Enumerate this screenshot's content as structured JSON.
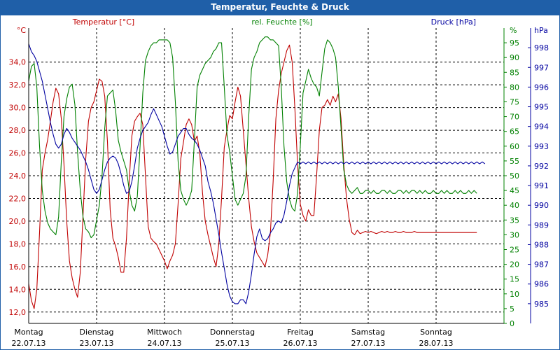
{
  "window": {
    "title": "Temperatur, Feuchte & Druck"
  },
  "chart_data": {
    "type": "line",
    "x": [
      "Montag 22.07.13",
      "Dienstag 23.07.13",
      "Mittwoch 24.07.13",
      "Donnerstag 25.07.13",
      "Freitag 26.07.13",
      "Samstag 27.07.13",
      "Sonntag 28.07.13"
    ],
    "x_days": [
      "Montag",
      "Dienstag",
      "Mittwoch",
      "Donnerstag",
      "Freitag",
      "Samstag",
      "Sonntag"
    ],
    "x_dates": [
      "22.07.13",
      "23.07.13",
      "24.07.13",
      "25.07.13",
      "26.07.13",
      "27.07.13",
      "28.07.13"
    ],
    "grid": true,
    "axes": {
      "temperature": {
        "label": "Temperatur [°C]",
        "unit": "°C",
        "ylim": [
          11,
          37
        ],
        "ticks": [
          12.0,
          14.0,
          16.0,
          18.0,
          20.0,
          22.0,
          24.0,
          26.0,
          28.0,
          30.0,
          32.0,
          34.0
        ],
        "tick_labels": [
          "12,0",
          "14,0",
          "16,0",
          "18,0",
          "20,0",
          "22,0",
          "24,0",
          "26,0",
          "28,0",
          "30,0",
          "32,0",
          "34,0"
        ],
        "color": "#c00000"
      },
      "humidity": {
        "label": "rel. Feuchte [%]",
        "unit": "%",
        "ylim": [
          0,
          100
        ],
        "ticks": [
          0,
          5,
          10,
          15,
          20,
          25,
          30,
          35,
          40,
          45,
          50,
          55,
          60,
          65,
          70,
          75,
          80,
          85,
          90,
          95
        ],
        "color": "#008000"
      },
      "pressure": {
        "label": "Druck [hPa]",
        "unit": "hPa",
        "ylim": [
          984,
          999
        ],
        "ticks": [
          985,
          986,
          987,
          988,
          989,
          990,
          991,
          992,
          993,
          994,
          995,
          996,
          997,
          998
        ],
        "color": "#0000a0"
      }
    },
    "series": [
      {
        "name": "Temperatur [°C]",
        "axis": "temperature",
        "color": "#c00000",
        "x_days": [
          0,
          0.04,
          0.08,
          0.12,
          0.16,
          0.2,
          0.24,
          0.28,
          0.32,
          0.36,
          0.4,
          0.44,
          0.48,
          0.52,
          0.56,
          0.6,
          0.64,
          0.68,
          0.72,
          0.76,
          0.8,
          0.84,
          0.88,
          0.92,
          0.96,
          1.0,
          1.04,
          1.08,
          1.12,
          1.16,
          1.2,
          1.24,
          1.28,
          1.32,
          1.36,
          1.4,
          1.44,
          1.48,
          1.52,
          1.56,
          1.6,
          1.64,
          1.68,
          1.72,
          1.76,
          1.8,
          1.84,
          1.88,
          1.92,
          1.96,
          2.0,
          2.04,
          2.08,
          2.12,
          2.16,
          2.2,
          2.24,
          2.28,
          2.32,
          2.36,
          2.4,
          2.44,
          2.48,
          2.52,
          2.56,
          2.6,
          2.64,
          2.68,
          2.72,
          2.76,
          2.8,
          2.84,
          2.88,
          2.92,
          2.96,
          3.0,
          3.04,
          3.08,
          3.12,
          3.16,
          3.2,
          3.24,
          3.28,
          3.32,
          3.36,
          3.4,
          3.44,
          3.48,
          3.52,
          3.56,
          3.6,
          3.64,
          3.68,
          3.72,
          3.76,
          3.8,
          3.84,
          3.88,
          3.92,
          3.96,
          4.0,
          4.04,
          4.08,
          4.12,
          4.16,
          4.2,
          4.24,
          4.28,
          4.32,
          4.36,
          4.4,
          4.44,
          4.48,
          4.52,
          4.56,
          4.6,
          4.64,
          4.68,
          4.72,
          4.76,
          4.8,
          4.84,
          4.88,
          4.92,
          4.96,
          5.0,
          5.04,
          5.08,
          5.12,
          5.16,
          5.2,
          5.24,
          5.28,
          5.32,
          5.36,
          5.4,
          5.44,
          5.48,
          5.52,
          5.56,
          5.6,
          5.64,
          5.68,
          5.72,
          5.76,
          5.8,
          5.84,
          5.88,
          5.92,
          5.96,
          6.0,
          6.04,
          6.08,
          6.12,
          6.16,
          6.2,
          6.24,
          6.28,
          6.32,
          6.36,
          6.4,
          6.44,
          6.48,
          6.52,
          6.56,
          6.6,
          6.64,
          6.68,
          6.72,
          6.76,
          6.8,
          6.84,
          6.88,
          6.92,
          6.96
        ],
        "values": [
          14.5,
          13.0,
          12.3,
          14.0,
          19.0,
          24.5,
          26.0,
          27.2,
          28.8,
          30.5,
          31.7,
          31.2,
          29.0,
          25.0,
          20.0,
          16.5,
          15.0,
          14.0,
          13.3,
          15.5,
          20.5,
          25.5,
          28.8,
          30.0,
          30.5,
          31.5,
          32.5,
          32.3,
          31.0,
          27.0,
          21.0,
          18.5,
          17.8,
          16.8,
          15.5,
          15.5,
          18.5,
          23.5,
          27.5,
          28.8,
          29.2,
          29.5,
          28.5,
          24.0,
          19.5,
          18.5,
          18.2,
          18.0,
          17.5,
          17.0,
          16.5,
          15.8,
          16.5,
          17.0,
          18.0,
          21.5,
          25.5,
          27.0,
          28.5,
          29.0,
          28.5,
          27.0,
          27.5,
          26.0,
          22.5,
          20.0,
          18.8,
          17.8,
          16.8,
          16.0,
          18.0,
          22.0,
          26.5,
          28.0,
          29.3,
          29.0,
          30.5,
          31.8,
          31.0,
          28.0,
          25.0,
          22.0,
          19.5,
          18.2,
          17.2,
          16.8,
          16.4,
          16.0,
          17.0,
          19.0,
          23.5,
          29.0,
          31.5,
          33.0,
          34.0,
          35.0,
          35.5,
          34.0,
          30.0,
          25.0,
          21.5,
          20.5,
          20.0,
          21.0,
          20.5,
          20.5,
          24.0,
          28.0,
          30.0,
          30.2,
          30.7,
          30.2,
          31.0,
          30.5,
          31.2,
          29.0,
          25.0,
          22.0,
          20.2,
          19.0,
          18.8,
          19.2,
          18.9,
          19.0,
          19.1,
          19.0,
          19.1,
          19.0,
          18.9,
          19.0,
          19.1,
          19.0,
          19.1,
          19.0,
          19.0,
          19.1,
          19.0,
          19.0,
          19.1,
          19.0,
          19.0,
          19.0,
          19.1,
          19.0,
          19.0,
          19.0,
          19.0,
          19.0,
          19.0,
          19.0,
          19.0,
          19.0,
          19.0,
          19.0,
          19.0,
          19.0,
          19.0,
          19.0,
          19.0,
          19.0,
          19.0,
          19.0,
          19.0,
          19.0,
          19.0,
          19.0
        ]
      },
      {
        "name": "rel. Feuchte [%]",
        "axis": "humidity",
        "color": "#008000",
        "x_days": [
          0,
          0.04,
          0.08,
          0.12,
          0.16,
          0.2,
          0.24,
          0.28,
          0.32,
          0.36,
          0.4,
          0.44,
          0.48,
          0.52,
          0.56,
          0.6,
          0.64,
          0.68,
          0.72,
          0.76,
          0.8,
          0.84,
          0.88,
          0.92,
          0.96,
          1.0,
          1.04,
          1.08,
          1.12,
          1.16,
          1.2,
          1.24,
          1.28,
          1.32,
          1.36,
          1.4,
          1.44,
          1.48,
          1.52,
          1.56,
          1.6,
          1.64,
          1.68,
          1.72,
          1.76,
          1.8,
          1.84,
          1.88,
          1.92,
          1.96,
          2.0,
          2.04,
          2.08,
          2.12,
          2.16,
          2.2,
          2.24,
          2.28,
          2.32,
          2.36,
          2.4,
          2.44,
          2.48,
          2.52,
          2.56,
          2.6,
          2.64,
          2.68,
          2.72,
          2.76,
          2.8,
          2.84,
          2.88,
          2.92,
          2.96,
          3.0,
          3.04,
          3.08,
          3.12,
          3.16,
          3.2,
          3.24,
          3.28,
          3.32,
          3.36,
          3.4,
          3.44,
          3.48,
          3.52,
          3.56,
          3.6,
          3.64,
          3.68,
          3.72,
          3.76,
          3.8,
          3.84,
          3.88,
          3.92,
          3.96,
          4.0,
          4.04,
          4.08,
          4.12,
          4.16,
          4.2,
          4.24,
          4.28,
          4.32,
          4.36,
          4.4,
          4.44,
          4.48,
          4.52,
          4.56,
          4.6,
          4.64,
          4.68,
          4.72,
          4.76,
          4.8,
          4.84,
          4.88,
          4.92,
          4.96,
          5.0,
          5.04,
          5.08,
          5.12,
          5.16,
          5.2,
          5.24,
          5.28,
          5.32,
          5.36,
          5.4,
          5.44,
          5.48,
          5.52,
          5.56,
          5.6,
          5.64,
          5.68,
          5.72,
          5.76,
          5.8,
          5.84,
          5.88,
          5.92,
          5.96,
          6.0,
          6.04,
          6.08,
          6.12,
          6.16,
          6.2,
          6.24,
          6.28,
          6.32,
          6.36,
          6.4,
          6.44,
          6.48,
          6.52,
          6.56,
          6.6,
          6.64,
          6.68,
          6.72,
          6.76,
          6.8,
          6.84,
          6.88,
          6.92,
          6.96
        ],
        "values": [
          82,
          87,
          88,
          80,
          60,
          45,
          38,
          34,
          32,
          31,
          30,
          36,
          55,
          70,
          76,
          80,
          81,
          74,
          58,
          45,
          36,
          32,
          31,
          29,
          30,
          35,
          40,
          50,
          66,
          77,
          78,
          79,
          72,
          62,
          58,
          55,
          52,
          45,
          40,
          38,
          43,
          60,
          78,
          89,
          92,
          94,
          95,
          95,
          96,
          96,
          96,
          96,
          95,
          90,
          75,
          55,
          45,
          42,
          40,
          42,
          45,
          62,
          80,
          84,
          86,
          88,
          89,
          90,
          92,
          93,
          95,
          95,
          80,
          64,
          58,
          50,
          42,
          40,
          42,
          44,
          50,
          70,
          86,
          90,
          92,
          95,
          96,
          97,
          97,
          96,
          96,
          95,
          94,
          80,
          60,
          48,
          42,
          39,
          38,
          44,
          60,
          78,
          82,
          86,
          83,
          81,
          80,
          77,
          85,
          93,
          96,
          95,
          93,
          90,
          80,
          66,
          52,
          47,
          45,
          44,
          45,
          46,
          44,
          44,
          45,
          45,
          44,
          45,
          44,
          44,
          45,
          45,
          44,
          45,
          44,
          44,
          45,
          45,
          44,
          45,
          44,
          45,
          45,
          44,
          45,
          44,
          45,
          44,
          44,
          45,
          44,
          44,
          45,
          44,
          45,
          44,
          44,
          45,
          44,
          45,
          44,
          44,
          45,
          44,
          45,
          44
        ]
      },
      {
        "name": "Druck [hPa]",
        "axis": "pressure",
        "color": "#0000a0",
        "x_days": [
          0,
          0.04,
          0.08,
          0.12,
          0.16,
          0.2,
          0.24,
          0.28,
          0.32,
          0.36,
          0.4,
          0.44,
          0.48,
          0.52,
          0.56,
          0.6,
          0.64,
          0.68,
          0.72,
          0.76,
          0.8,
          0.84,
          0.88,
          0.92,
          0.96,
          1.0,
          1.04,
          1.08,
          1.12,
          1.16,
          1.2,
          1.24,
          1.28,
          1.32,
          1.36,
          1.4,
          1.44,
          1.48,
          1.52,
          1.56,
          1.6,
          1.64,
          1.68,
          1.72,
          1.76,
          1.8,
          1.84,
          1.88,
          1.92,
          1.96,
          2.0,
          2.04,
          2.08,
          2.12,
          2.16,
          2.2,
          2.24,
          2.28,
          2.32,
          2.36,
          2.4,
          2.44,
          2.48,
          2.52,
          2.56,
          2.6,
          2.64,
          2.68,
          2.72,
          2.76,
          2.8,
          2.84,
          2.88,
          2.92,
          2.96,
          3.0,
          3.04,
          3.08,
          3.12,
          3.16,
          3.2,
          3.24,
          3.28,
          3.32,
          3.36,
          3.4,
          3.44,
          3.48,
          3.52,
          3.56,
          3.6,
          3.64,
          3.68,
          3.72,
          3.76,
          3.8,
          3.84,
          3.88,
          3.92,
          3.96,
          4.0,
          4.04,
          4.08,
          4.12,
          4.16,
          4.2,
          4.24,
          4.28,
          4.32,
          4.36,
          4.4,
          4.44,
          4.48,
          4.52,
          4.56,
          4.6,
          4.64,
          4.68,
          4.72,
          4.76,
          4.8,
          4.84,
          4.88,
          4.92,
          4.96,
          5.0,
          5.04,
          5.08,
          5.12,
          5.16,
          5.2,
          5.24,
          5.28,
          5.32,
          5.36,
          5.4,
          5.44,
          5.48,
          5.52,
          5.56,
          5.6,
          5.64,
          5.68,
          5.72,
          5.76,
          5.8,
          5.84,
          5.88,
          5.92,
          5.96,
          6.0,
          6.04,
          6.08,
          6.12,
          6.16,
          6.2,
          6.24,
          6.28,
          6.32,
          6.36,
          6.4,
          6.44,
          6.48,
          6.52,
          6.56,
          6.6,
          6.64,
          6.68,
          6.72,
          6.76,
          6.8,
          6.84,
          6.88,
          6.92,
          6.96
        ],
        "values": [
          998.2,
          997.8,
          997.6,
          997.3,
          996.8,
          996.3,
          995.6,
          994.9,
          994.2,
          993.6,
          993.1,
          992.9,
          993.1,
          993.6,
          993.9,
          993.7,
          993.4,
          993.2,
          993.0,
          992.8,
          992.5,
          992.2,
          991.8,
          991.3,
          990.8,
          990.6,
          990.8,
          991.3,
          991.8,
          992.2,
          992.4,
          992.5,
          992.4,
          992.1,
          991.6,
          991.0,
          990.6,
          990.7,
          991.2,
          992.0,
          992.9,
          993.4,
          993.8,
          994.0,
          994.2,
          994.6,
          994.9,
          994.6,
          994.3,
          994.0,
          993.5,
          993.0,
          992.6,
          992.7,
          993.1,
          993.5,
          993.7,
          993.9,
          993.9,
          993.6,
          993.4,
          993.3,
          993.1,
          992.8,
          992.4,
          992.0,
          991.2,
          990.7,
          990.1,
          989.3,
          988.5,
          987.6,
          986.8,
          986.0,
          985.4,
          985.1,
          985.0,
          985.0,
          985.2,
          985.2,
          985.0,
          985.6,
          986.5,
          987.5,
          988.4,
          988.8,
          988.3,
          988.2,
          988.3,
          988.6,
          988.8,
          989.1,
          989.2,
          989.1,
          989.5,
          990.2,
          991.0,
          991.6,
          991.9,
          992.2,
          992.1,
          992.2,
          992.1,
          992.2,
          992.1,
          992.2,
          992.1,
          992.2,
          992.1,
          992.2,
          992.1,
          992.2,
          992.1,
          992.2,
          992.1,
          992.2,
          992.1,
          992.2,
          992.1,
          992.2,
          992.1,
          992.2,
          992.1,
          992.2,
          992.1,
          992.2,
          992.1,
          992.2,
          992.1,
          992.2,
          992.1,
          992.2,
          992.1,
          992.2,
          992.1,
          992.2,
          992.1,
          992.2,
          992.1,
          992.2,
          992.1,
          992.2,
          992.1,
          992.2,
          992.1,
          992.2,
          992.1,
          992.2,
          992.1,
          992.2,
          992.1,
          992.2,
          992.1,
          992.2,
          992.1,
          992.2,
          992.1,
          992.2,
          992.1,
          992.2,
          992.1,
          992.2,
          992.1,
          992.2,
          992.1,
          992.2,
          992.1,
          992.2,
          992.1
        ]
      }
    ]
  }
}
